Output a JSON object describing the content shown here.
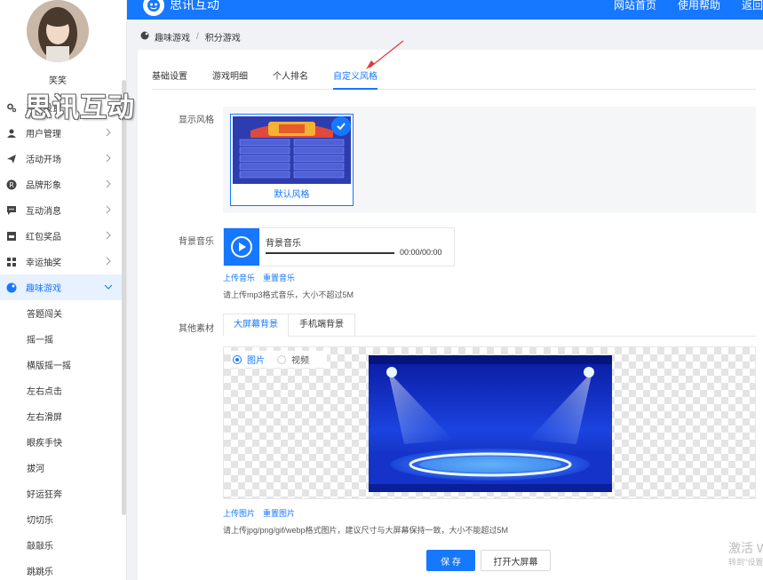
{
  "sidebar": {
    "username": "笑笑",
    "watermark": "思讯互动",
    "menu": [
      {
        "label": "系统设置",
        "icon": "gear-icon"
      },
      {
        "label": "用户管理",
        "icon": "user-icon"
      },
      {
        "label": "活动开场",
        "icon": "send-icon"
      },
      {
        "label": "品牌形象",
        "icon": "brand-icon"
      },
      {
        "label": "互动消息",
        "icon": "message-icon"
      },
      {
        "label": "红包奖品",
        "icon": "gift-icon"
      },
      {
        "label": "幸运抽奖",
        "icon": "lottery-icon"
      },
      {
        "label": "趣味游戏",
        "icon": "game-icon"
      }
    ],
    "submenu": [
      "答题闯关",
      "摇一摇",
      "横版摇一摇",
      "左右点击",
      "左右滑屏",
      "眼疾手快",
      "拔河",
      "好运狂奔",
      "切切乐",
      "敲敲乐",
      "跳跳乐"
    ]
  },
  "topbar": {
    "brand": "思讯互动",
    "nav": [
      "网站首页",
      "使用帮助",
      "返回"
    ]
  },
  "breadcrumb": [
    "趣味游戏",
    "积分游戏"
  ],
  "tabs": [
    "基础设置",
    "游戏明细",
    "个人排名",
    "自定义风格"
  ],
  "display_style": {
    "label": "显示风格",
    "style_name": "默认风格"
  },
  "music": {
    "label": "背景音乐",
    "title": "背景音乐",
    "time": "00:00/00:00",
    "upload": "上传音乐",
    "reset": "重置音乐",
    "hint": "请上传mp3格式音乐，大小不超过5M"
  },
  "materials": {
    "label": "其他素材",
    "subtabs": [
      "大屏幕背景",
      "手机端背景"
    ],
    "radio_image": "图片",
    "radio_video": "视频",
    "upload": "上传图片",
    "reset": "重置图片",
    "hint": "请上传jpg/png/gif/webp格式图片，建议尺寸与大屏幕保持一致，大小不能超过5M"
  },
  "actions": {
    "save": "保 存",
    "open_screen": "打开大屏幕"
  },
  "activation": {
    "line1": "激活 W",
    "line2": "转到\"设置"
  },
  "colors": {
    "primary": "#1677ff",
    "sidebar_active_bg": "#e8f1fe"
  }
}
